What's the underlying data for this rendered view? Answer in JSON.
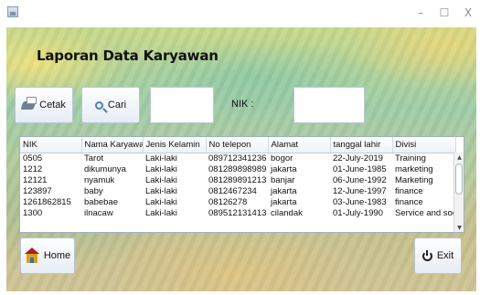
{
  "window": {
    "min_glyph": "–",
    "max_glyph": "☐",
    "close_glyph": "X"
  },
  "form": {
    "title": "Laporan Data Karyawan",
    "cetak_label": "Cetak",
    "cari_label": "Cari",
    "search_value": "",
    "nik_label": "NIK :",
    "nik_value": "",
    "home_label": "Home",
    "exit_label": "Exit"
  },
  "icons": {
    "cetak": "printer-icon",
    "cari": "search-icon",
    "home": "home-icon",
    "exit": "power-icon"
  },
  "table": {
    "columns": [
      "NIK",
      "Nama Karyawan",
      "Jenis Kelamin",
      "No telepon",
      "Alamat",
      "tanggal lahir",
      "Divisi"
    ],
    "rows": [
      [
        "0505",
        "Tarot",
        "Laki-laki",
        "089712341236",
        "bogor",
        "22-July-2019",
        "Training"
      ],
      [
        "1212",
        "dikumunya",
        "Laki-laki",
        "081289898989",
        "jakarta",
        "01-June-1985",
        "marketing"
      ],
      [
        "12121",
        "nyamuk",
        "Laki-laki",
        "081289891213",
        "banjar",
        "06-June-1992",
        "Marketing"
      ],
      [
        "123897",
        "baby",
        "Laki-laki",
        "0812467234",
        "jakarta",
        "12-June-1997",
        "finance"
      ],
      [
        "1261862815",
        "babebae",
        "Laki-laki",
        "08126278",
        "jakarta",
        "03-June-1983",
        "finance"
      ],
      [
        "1300",
        "ilnacaw",
        "Laki-laki",
        "089512131413",
        "cilandak",
        "01-July-1990",
        "Service and soc"
      ]
    ]
  }
}
